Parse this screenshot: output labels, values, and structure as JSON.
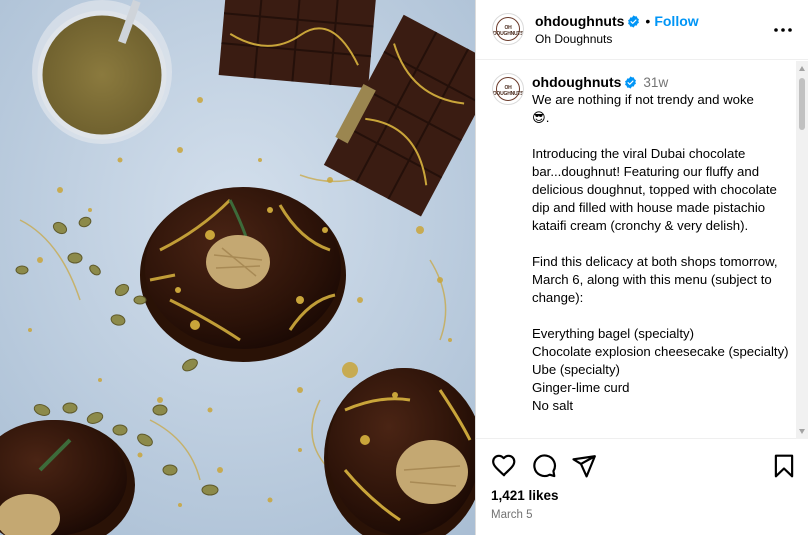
{
  "post": {
    "username": "ohdoughnuts",
    "display_name": "Oh Doughnuts",
    "follow_label": "Follow",
    "separator": "•",
    "avatar_text": "OH DOUGHNUTS",
    "more_icon": "more-horizontal-icon",
    "verified_icon": "verified-badge-icon"
  },
  "caption": {
    "username": "ohdoughnuts",
    "time": "31w",
    "text": "We are nothing if not trendy and woke\n😎.\n\nIntroducing the viral Dubai chocolate bar...doughnut! Featuring our fluffy and delicious doughnut, topped with chocolate dip and filled with house made pistachio kataifi cream (cronchy & very delish).\n\nFind this delicacy at both shops tomorrow, March 6, along with this menu (subject to change):\n\nEverything bagel (specialty)\nChocolate explosion cheesecake (specialty)\nUbe (specialty)\nGinger-lime curd\nNo salt"
  },
  "actions": {
    "like_icon": "heart-icon",
    "comment_icon": "comment-icon",
    "share_icon": "paper-plane-icon",
    "save_icon": "bookmark-icon"
  },
  "stats": {
    "likes": "1,421 likes",
    "date": "March 5"
  },
  "colors": {
    "link_blue": "#0095f6",
    "verified_blue": "#0095f6",
    "muted_gray": "#737373",
    "border": "#dbdbdb",
    "photo_background": "#b7c9dd",
    "chocolate": "#2b1208",
    "gold": "#c9a53a",
    "pistachio": "#8c8a4a"
  }
}
